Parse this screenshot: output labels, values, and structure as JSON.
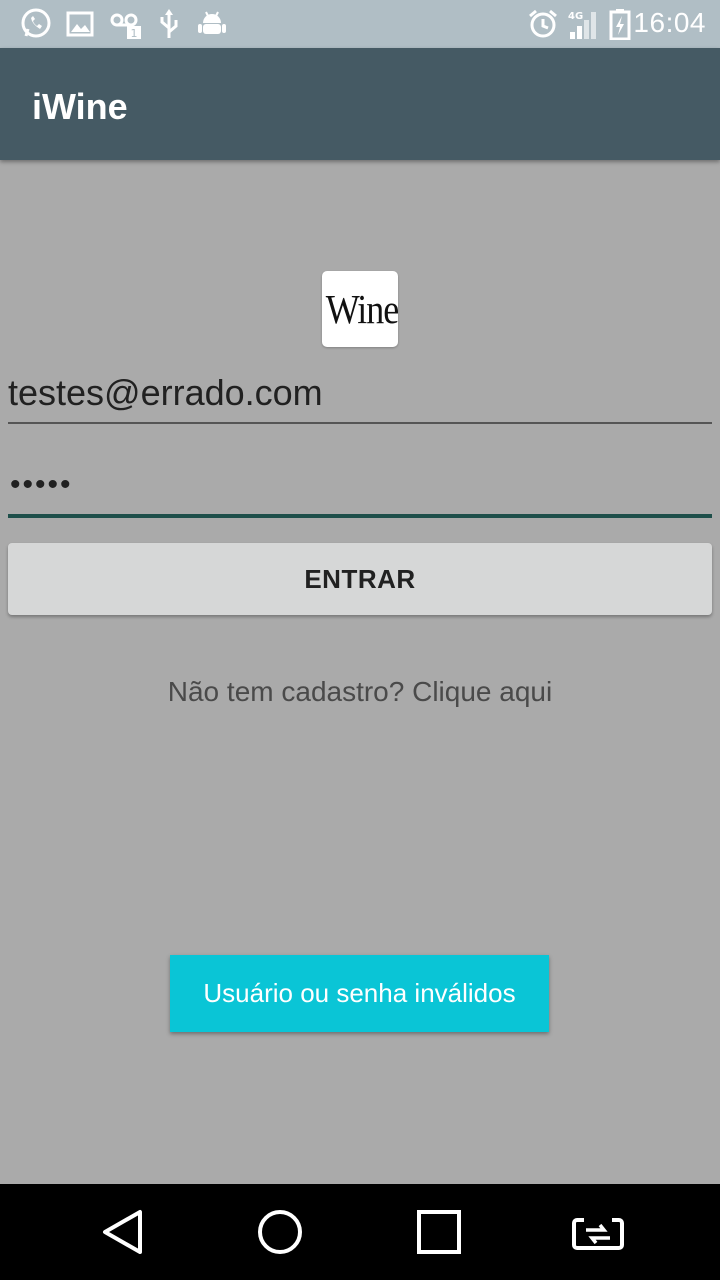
{
  "status_bar": {
    "time": "16:04",
    "network": "4G",
    "icons": [
      "whatsapp-icon",
      "image-icon",
      "voicemail-icon",
      "usb-icon",
      "android-debug-icon",
      "alarm-icon",
      "signal-icon",
      "battery-charging-icon"
    ]
  },
  "app_bar": {
    "title": "iWine"
  },
  "logo": {
    "text": "Wine"
  },
  "login": {
    "email_value": "testes@errado.com",
    "password_value": "•••••",
    "submit_label": "ENTRAR",
    "register_text": "Não tem cadastro? Clique aqui"
  },
  "toast": {
    "message": "Usuário ou senha inválidos"
  },
  "nav_bar": {
    "buttons": [
      "back-icon",
      "home-icon",
      "recents-icon",
      "switch-app-icon"
    ]
  },
  "colors": {
    "status_bar": "#b0bec5",
    "app_bar": "#455a64",
    "background": "#aaaaaa",
    "toast": "#0ac5d6",
    "field_underline_focused": "#1e4f4a"
  }
}
